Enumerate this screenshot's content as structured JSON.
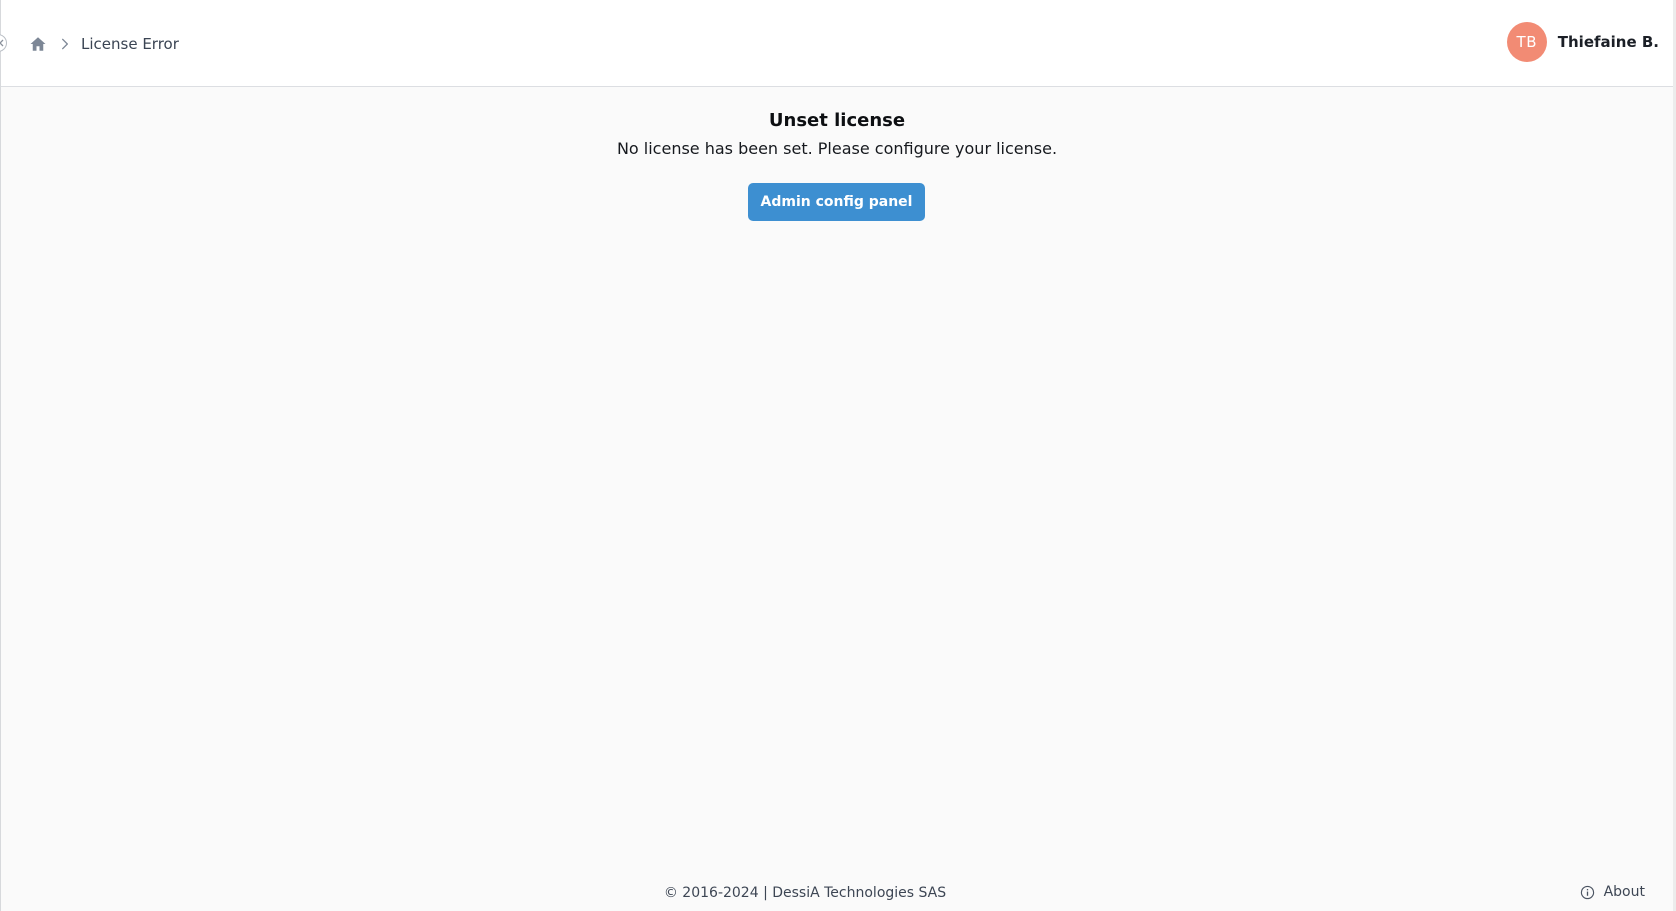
{
  "breadcrumb": {
    "home_icon": "home-icon",
    "separator_icon": "chevron-right-icon",
    "current": "License Error"
  },
  "user": {
    "initials": "TB",
    "name": "Thiefaine B.",
    "avatar_color": "#f28b74"
  },
  "error": {
    "title": "Unset license",
    "message": "No license has been set. Please configure your license.",
    "button_label": "Admin config panel"
  },
  "footer": {
    "copyright": "© 2016-2024 | DessiA Technologies SAS",
    "about_label": "About",
    "about_icon": "info-icon"
  },
  "colors": {
    "accent": "#3d8fd1",
    "background": "#fafafa",
    "header_background": "#ffffff"
  }
}
